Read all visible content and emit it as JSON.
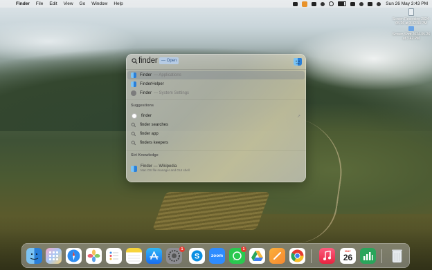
{
  "menubar": {
    "app_name": "Finder",
    "items": [
      "File",
      "Edit",
      "View",
      "Go",
      "Window",
      "Help"
    ],
    "clock": "Sun 26 May  3:43 PM"
  },
  "desktop_files": [
    {
      "name": "Screen Recording 2024-05-26 at 3.42.33 PM"
    },
    {
      "name": "Screen Shot 2024-05-26 at 3.42 PM"
    }
  ],
  "spotlight": {
    "query": "finder",
    "hint": "— Open",
    "top_hits": [
      {
        "title": "Finder",
        "subtitle": "— Applications",
        "icon": "finder-icon",
        "selected": true
      },
      {
        "title": "FinderHelper",
        "subtitle": "",
        "icon": "finder-icon",
        "selected": false
      },
      {
        "title": "Finder",
        "subtitle": "— System Settings",
        "icon": "gear-icon",
        "selected": false
      }
    ],
    "suggestions_label": "Suggestions",
    "suggestions": [
      "finder",
      "finder searches",
      "finder app",
      "finders keepers"
    ],
    "siri_label": "Siri Knowledge",
    "siri": {
      "title": "Finder — Wikipedia",
      "subtitle": "Mac OS file manager and GUI shell"
    }
  },
  "dock": {
    "calendar_month": "MAY",
    "calendar_day": "26",
    "settings_badge": "1",
    "whatsapp_badge": "1",
    "zoom_label": "zoom",
    "skype_label": "S"
  }
}
